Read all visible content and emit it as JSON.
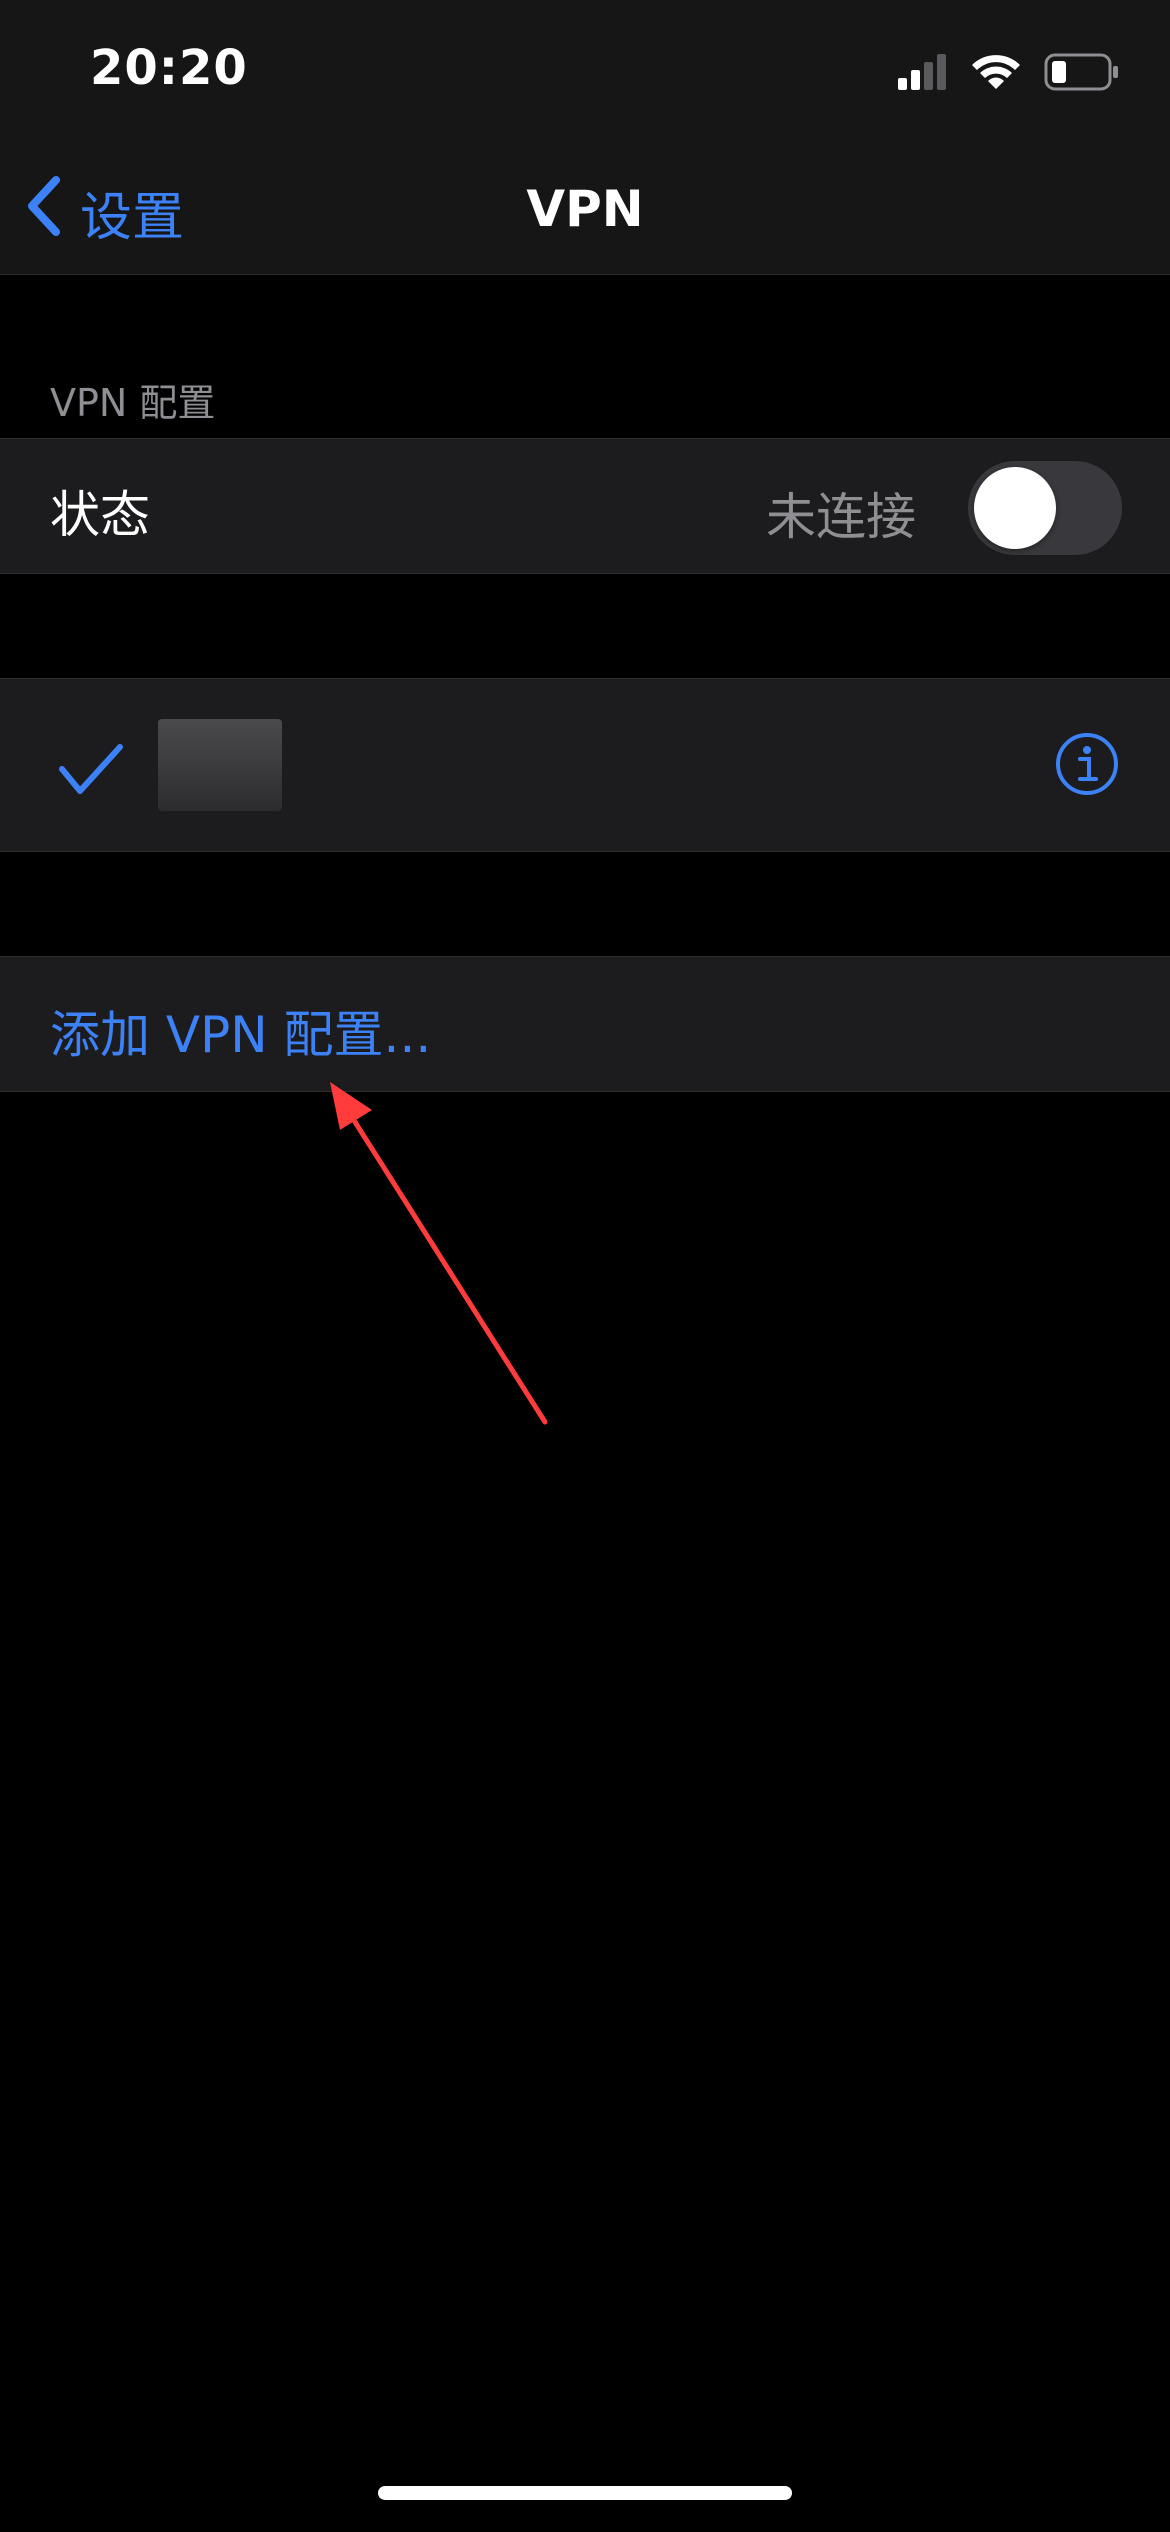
{
  "status_bar": {
    "time": "20:20"
  },
  "nav": {
    "back_label": "设置",
    "title": "VPN"
  },
  "section": {
    "header": "VPN 配置"
  },
  "status_row": {
    "label": "状态",
    "value": "未连接",
    "toggle_on": false
  },
  "profile_row": {
    "selected": true
  },
  "add_row": {
    "label": "添加 VPN 配置..."
  },
  "colors": {
    "accent": "#3c82f6",
    "background": "#000000",
    "cell": "#1c1c1e",
    "secondary_text": "#8e8e93",
    "annotation": "#ff3b3b"
  },
  "icons": [
    "cellular-signal-icon",
    "wifi-icon",
    "battery-icon",
    "chevron-left-icon",
    "checkmark-icon",
    "info-icon"
  ]
}
